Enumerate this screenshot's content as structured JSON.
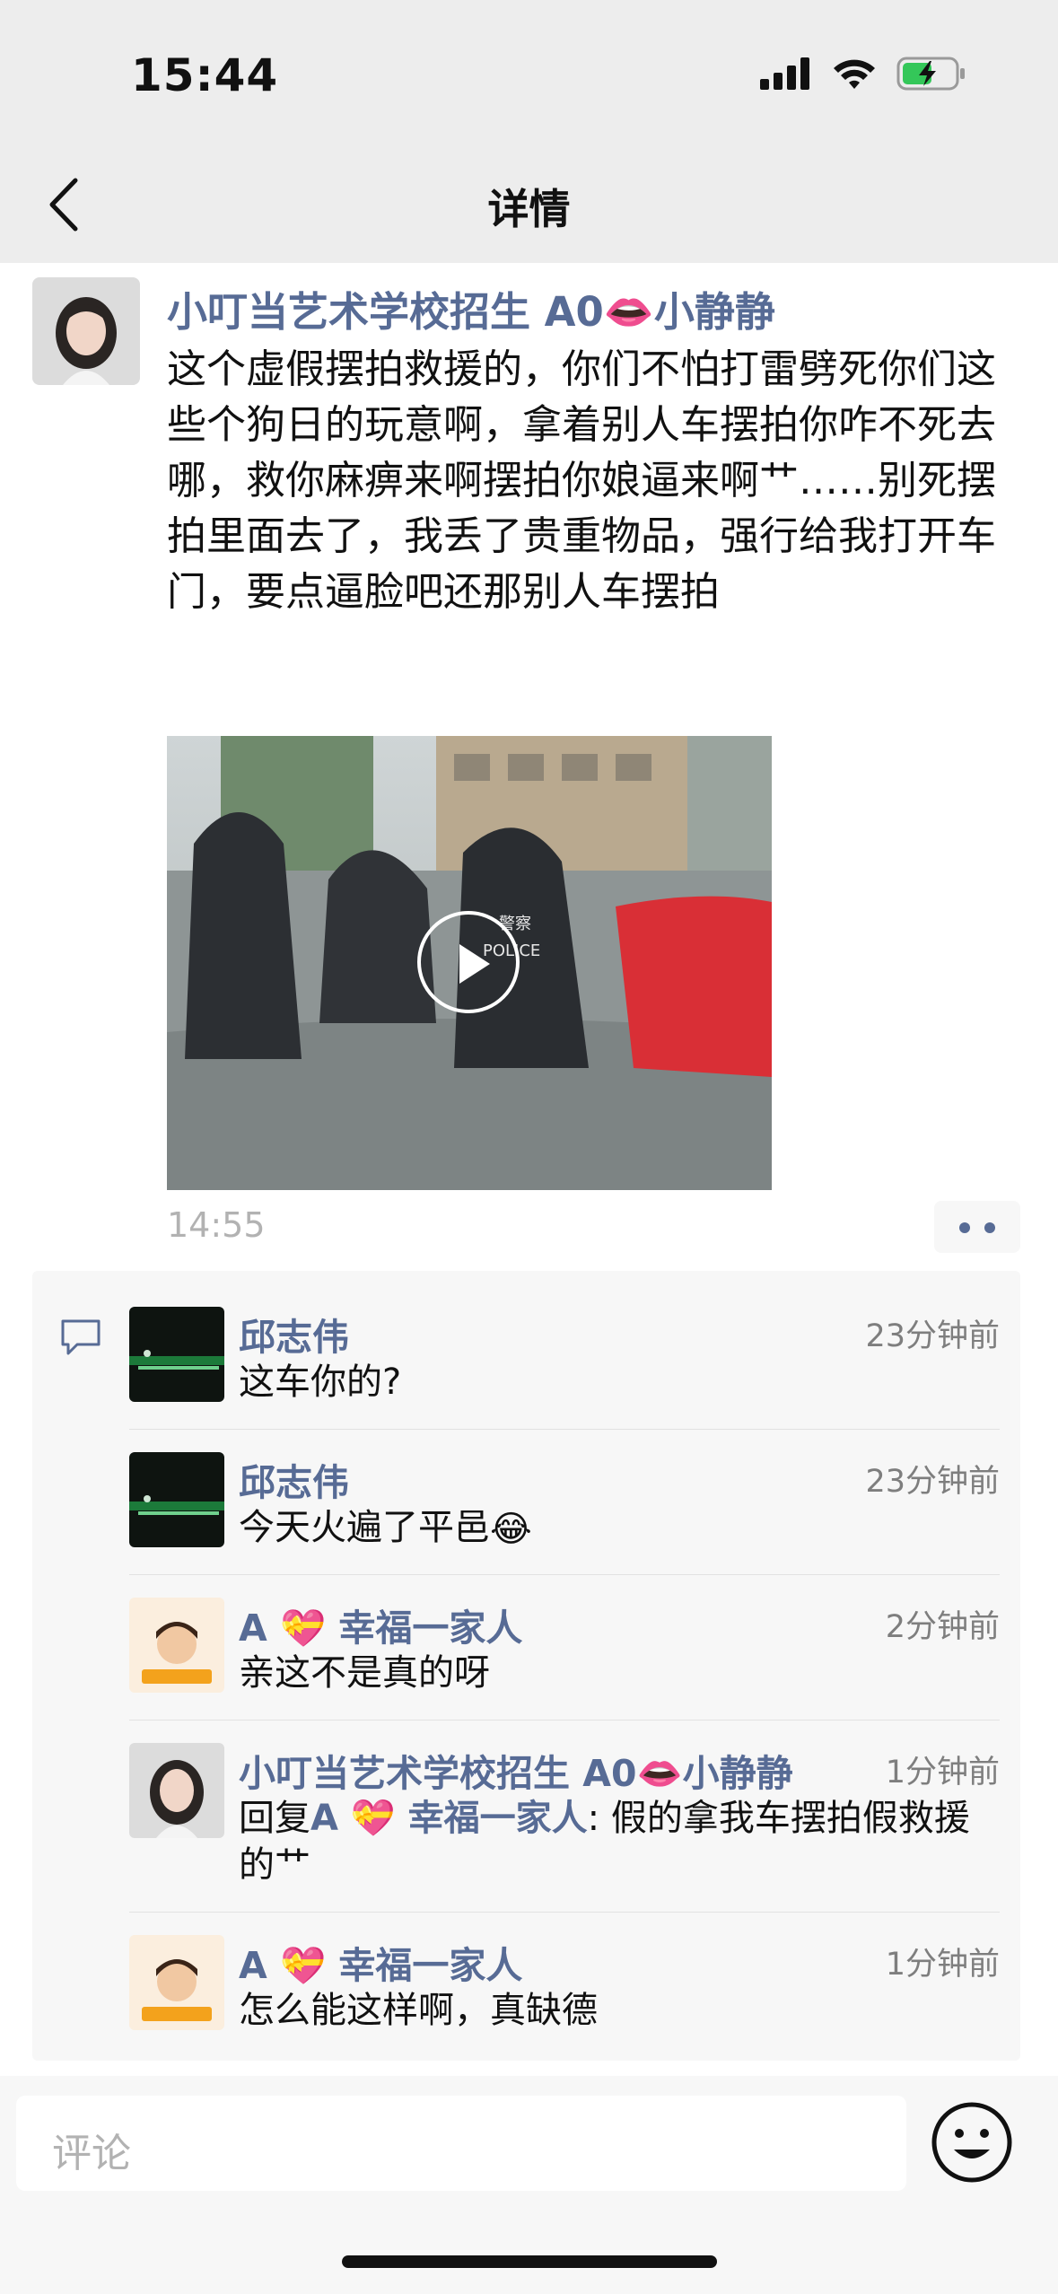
{
  "status_bar": {
    "time": "15:44"
  },
  "nav": {
    "title": "详情"
  },
  "post": {
    "author": "小叮当艺术学校招生 A0👄小静静",
    "text": "这个虚假摆拍救援的，你们不怕打雷劈死你们这些个狗日的玩意啊，拿着别人车摆拍你咋不死去哪，救你麻痹来啊摆拍你娘逼来啊艹……别死摆拍里面去了，我丢了贵重物品，强行给我打开车门，要点逼脸吧还那别人车摆拍",
    "time": "14:55",
    "video_sign": "警察",
    "video_police": "POLICE"
  },
  "comments": [
    {
      "name": "邱志伟",
      "time": "23分钟前",
      "text": "这车你的?"
    },
    {
      "name": "邱志伟",
      "time": "23分钟前",
      "text": "今天火遍了平邑",
      "text_emoji": "😂"
    },
    {
      "name_prefix": "A",
      "name_emoji": "💝",
      "name_suffix": "幸福一家人",
      "time": "2分钟前",
      "text": "亲这不是真的呀"
    },
    {
      "name": "小叮当艺术学校招生 A0👄小静静",
      "time": "1分钟前",
      "reply_label": "回复",
      "reply_to": "A 💝 幸福一家人",
      "text": ": 假的拿我车摆拍假救援的艹"
    },
    {
      "name_prefix": "A",
      "name_emoji": "💝",
      "name_suffix": "幸福一家人",
      "time": "1分钟前",
      "text": "怎么能这样啊，真缺德"
    }
  ],
  "input": {
    "placeholder": "评论"
  },
  "icons": {
    "back": "chevron-left-icon",
    "play": "play-icon",
    "comment": "comment-icon",
    "emoji": "smiley-icon",
    "more": "more-dots-icon"
  },
  "colors": {
    "link": "#576b95",
    "background": "#ededed",
    "panel": "#f7f7f7"
  }
}
